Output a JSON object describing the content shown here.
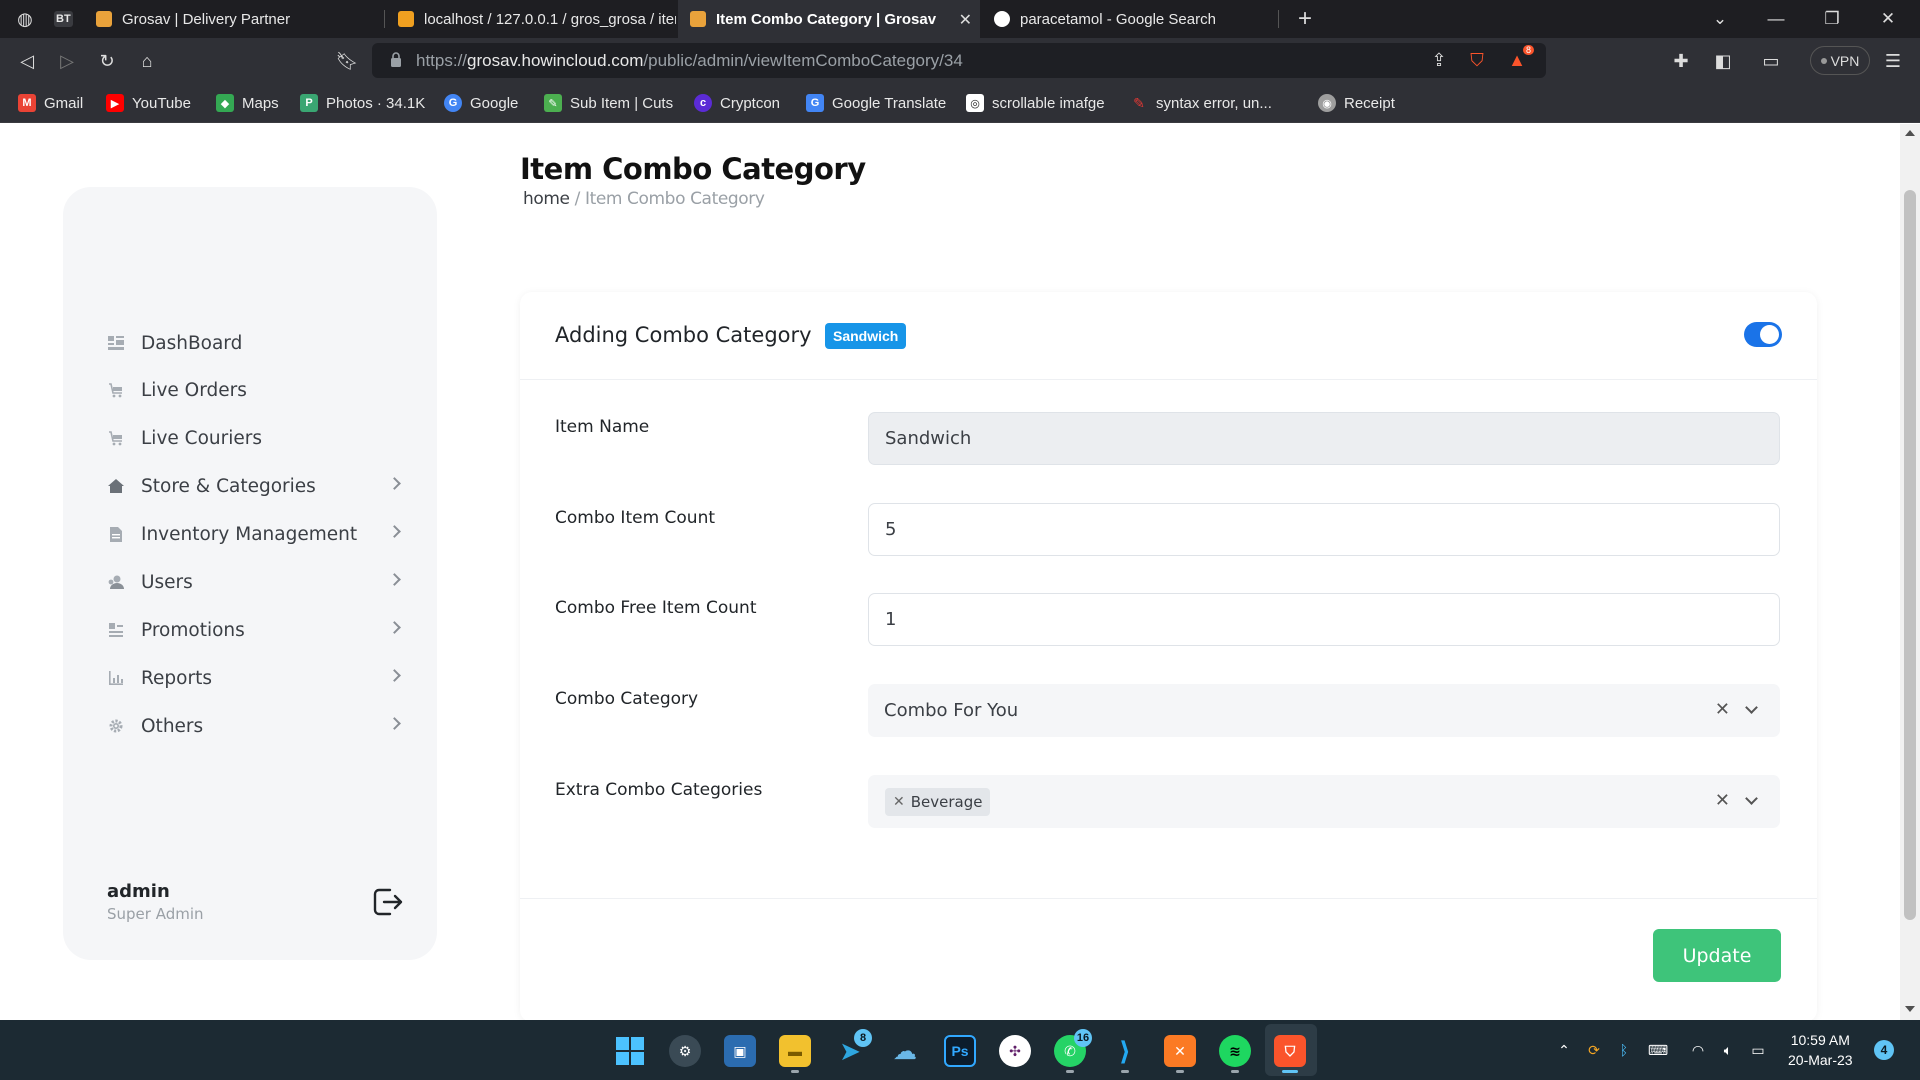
{
  "browser": {
    "tabs": [
      {
        "label": "BT"
      },
      {
        "label": "Grosav | Delivery Partner"
      },
      {
        "label": "localhost / 127.0.0.1 / gros_grosa / iter"
      },
      {
        "label": "Item Combo Category | Grosav",
        "active": true
      },
      {
        "label": "paracetamol - Google Search"
      }
    ],
    "url_scheme": "https://",
    "url_host": "grosav.howincloud.com",
    "url_path": "/public/admin/viewItemComboCategory/34",
    "vpn_label": "VPN",
    "brave_badge": "8",
    "bookmarks": [
      {
        "label": "Gmail",
        "color": "#ea4335",
        "glyph": "M"
      },
      {
        "label": "YouTube",
        "color": "#ff0000",
        "glyph": "▶"
      },
      {
        "label": "Maps",
        "color": "#34a853",
        "glyph": "◆"
      },
      {
        "label": "Photos · 34.1K",
        "color": "#3aa672",
        "glyph": "P"
      },
      {
        "label": "Google",
        "color": "#4285f4",
        "glyph": "G"
      },
      {
        "label": "Sub Item | Cuts",
        "color": "#4caf50",
        "glyph": "✎"
      },
      {
        "label": "Cryptcon",
        "color": "#5b2bd6",
        "glyph": "c"
      },
      {
        "label": "Google Translate",
        "color": "#4285f4",
        "glyph": "G"
      },
      {
        "label": "scrollable imafge",
        "color": "#ffffff",
        "glyph": "◎"
      },
      {
        "label": "syntax error, un...",
        "color": "#e53935",
        "glyph": "✎"
      },
      {
        "label": "Receipt",
        "color": "#9e9e9e",
        "glyph": "◉"
      }
    ]
  },
  "sidebar": {
    "items": [
      {
        "label": "DashBoard",
        "icon": "dashboard-icon",
        "submenu": false
      },
      {
        "label": "Live Orders",
        "icon": "cart-icon",
        "submenu": false
      },
      {
        "label": "Live Couriers",
        "icon": "cart-icon",
        "submenu": false
      },
      {
        "label": "Store & Categories",
        "icon": "home-icon",
        "submenu": true
      },
      {
        "label": "Inventory Management",
        "icon": "document-icon",
        "submenu": true
      },
      {
        "label": "Users",
        "icon": "users-icon",
        "submenu": true
      },
      {
        "label": "Promotions",
        "icon": "promotions-icon",
        "submenu": true
      },
      {
        "label": "Reports",
        "icon": "chart-icon",
        "submenu": true
      },
      {
        "label": "Others",
        "icon": "gear-icon",
        "submenu": true
      }
    ],
    "user_name": "admin",
    "user_role": "Super Admin"
  },
  "header": {
    "title": "Item Combo Category",
    "breadcrumb_home": "home",
    "breadcrumb_sep": " / ",
    "breadcrumb_current": "Item Combo Category"
  },
  "form": {
    "title": "Adding Combo Category",
    "badge": "Sandwich",
    "toggle_on": true,
    "item_name_label": "Item Name",
    "item_name_value": "Sandwich",
    "combo_item_count_label": "Combo Item Count",
    "combo_item_count_value": "5",
    "combo_free_item_count_label": "Combo Free Item Count",
    "combo_free_item_count_value": "1",
    "combo_category_label": "Combo Category",
    "combo_category_value": "Combo For You",
    "extra_combo_categories_label": "Extra Combo Categories",
    "extra_combo_categories_values": [
      "Beverage"
    ],
    "update_label": "Update"
  },
  "taskbar": {
    "whatsapp_badge": "16",
    "telegram_badge": "8",
    "time": "10:59 AM",
    "date": "20-Mar-23",
    "notifications": "4"
  },
  "colors": {
    "accent": "#1a73e8",
    "badge": "#1795e8",
    "update": "#3ec47a"
  }
}
